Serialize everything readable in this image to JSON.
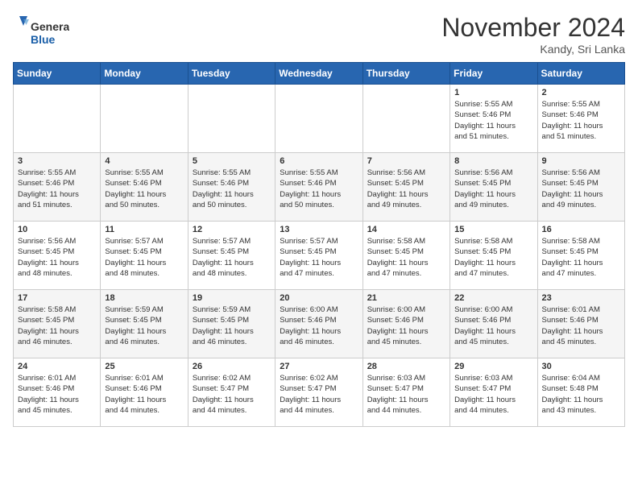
{
  "header": {
    "logo_line1": "General",
    "logo_line2": "Blue",
    "month": "November 2024",
    "location": "Kandy, Sri Lanka"
  },
  "weekdays": [
    "Sunday",
    "Monday",
    "Tuesday",
    "Wednesday",
    "Thursday",
    "Friday",
    "Saturday"
  ],
  "weeks": [
    [
      {
        "day": "",
        "info": ""
      },
      {
        "day": "",
        "info": ""
      },
      {
        "day": "",
        "info": ""
      },
      {
        "day": "",
        "info": ""
      },
      {
        "day": "",
        "info": ""
      },
      {
        "day": "1",
        "info": "Sunrise: 5:55 AM\nSunset: 5:46 PM\nDaylight: 11 hours\nand 51 minutes."
      },
      {
        "day": "2",
        "info": "Sunrise: 5:55 AM\nSunset: 5:46 PM\nDaylight: 11 hours\nand 51 minutes."
      }
    ],
    [
      {
        "day": "3",
        "info": "Sunrise: 5:55 AM\nSunset: 5:46 PM\nDaylight: 11 hours\nand 51 minutes."
      },
      {
        "day": "4",
        "info": "Sunrise: 5:55 AM\nSunset: 5:46 PM\nDaylight: 11 hours\nand 50 minutes."
      },
      {
        "day": "5",
        "info": "Sunrise: 5:55 AM\nSunset: 5:46 PM\nDaylight: 11 hours\nand 50 minutes."
      },
      {
        "day": "6",
        "info": "Sunrise: 5:55 AM\nSunset: 5:46 PM\nDaylight: 11 hours\nand 50 minutes."
      },
      {
        "day": "7",
        "info": "Sunrise: 5:56 AM\nSunset: 5:45 PM\nDaylight: 11 hours\nand 49 minutes."
      },
      {
        "day": "8",
        "info": "Sunrise: 5:56 AM\nSunset: 5:45 PM\nDaylight: 11 hours\nand 49 minutes."
      },
      {
        "day": "9",
        "info": "Sunrise: 5:56 AM\nSunset: 5:45 PM\nDaylight: 11 hours\nand 49 minutes."
      }
    ],
    [
      {
        "day": "10",
        "info": "Sunrise: 5:56 AM\nSunset: 5:45 PM\nDaylight: 11 hours\nand 48 minutes."
      },
      {
        "day": "11",
        "info": "Sunrise: 5:57 AM\nSunset: 5:45 PM\nDaylight: 11 hours\nand 48 minutes."
      },
      {
        "day": "12",
        "info": "Sunrise: 5:57 AM\nSunset: 5:45 PM\nDaylight: 11 hours\nand 48 minutes."
      },
      {
        "day": "13",
        "info": "Sunrise: 5:57 AM\nSunset: 5:45 PM\nDaylight: 11 hours\nand 47 minutes."
      },
      {
        "day": "14",
        "info": "Sunrise: 5:58 AM\nSunset: 5:45 PM\nDaylight: 11 hours\nand 47 minutes."
      },
      {
        "day": "15",
        "info": "Sunrise: 5:58 AM\nSunset: 5:45 PM\nDaylight: 11 hours\nand 47 minutes."
      },
      {
        "day": "16",
        "info": "Sunrise: 5:58 AM\nSunset: 5:45 PM\nDaylight: 11 hours\nand 47 minutes."
      }
    ],
    [
      {
        "day": "17",
        "info": "Sunrise: 5:58 AM\nSunset: 5:45 PM\nDaylight: 11 hours\nand 46 minutes."
      },
      {
        "day": "18",
        "info": "Sunrise: 5:59 AM\nSunset: 5:45 PM\nDaylight: 11 hours\nand 46 minutes."
      },
      {
        "day": "19",
        "info": "Sunrise: 5:59 AM\nSunset: 5:45 PM\nDaylight: 11 hours\nand 46 minutes."
      },
      {
        "day": "20",
        "info": "Sunrise: 6:00 AM\nSunset: 5:46 PM\nDaylight: 11 hours\nand 46 minutes."
      },
      {
        "day": "21",
        "info": "Sunrise: 6:00 AM\nSunset: 5:46 PM\nDaylight: 11 hours\nand 45 minutes."
      },
      {
        "day": "22",
        "info": "Sunrise: 6:00 AM\nSunset: 5:46 PM\nDaylight: 11 hours\nand 45 minutes."
      },
      {
        "day": "23",
        "info": "Sunrise: 6:01 AM\nSunset: 5:46 PM\nDaylight: 11 hours\nand 45 minutes."
      }
    ],
    [
      {
        "day": "24",
        "info": "Sunrise: 6:01 AM\nSunset: 5:46 PM\nDaylight: 11 hours\nand 45 minutes."
      },
      {
        "day": "25",
        "info": "Sunrise: 6:01 AM\nSunset: 5:46 PM\nDaylight: 11 hours\nand 44 minutes."
      },
      {
        "day": "26",
        "info": "Sunrise: 6:02 AM\nSunset: 5:47 PM\nDaylight: 11 hours\nand 44 minutes."
      },
      {
        "day": "27",
        "info": "Sunrise: 6:02 AM\nSunset: 5:47 PM\nDaylight: 11 hours\nand 44 minutes."
      },
      {
        "day": "28",
        "info": "Sunrise: 6:03 AM\nSunset: 5:47 PM\nDaylight: 11 hours\nand 44 minutes."
      },
      {
        "day": "29",
        "info": "Sunrise: 6:03 AM\nSunset: 5:47 PM\nDaylight: 11 hours\nand 44 minutes."
      },
      {
        "day": "30",
        "info": "Sunrise: 6:04 AM\nSunset: 5:48 PM\nDaylight: 11 hours\nand 43 minutes."
      }
    ]
  ]
}
